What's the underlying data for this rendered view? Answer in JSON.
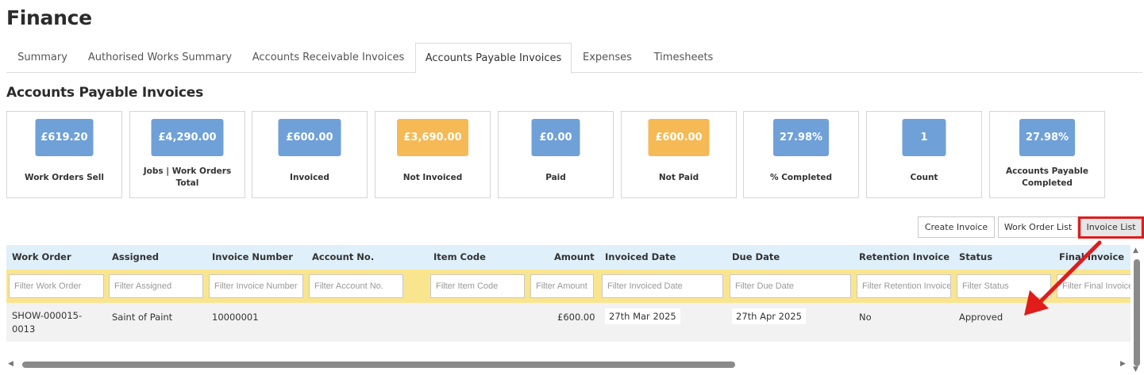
{
  "page": {
    "title": "Finance"
  },
  "tabs": [
    {
      "label": "Summary"
    },
    {
      "label": "Authorised Works Summary"
    },
    {
      "label": "Accounts Receivable Invoices"
    },
    {
      "label": "Accounts Payable Invoices"
    },
    {
      "label": "Expenses"
    },
    {
      "label": "Timesheets"
    }
  ],
  "active_tab": "Accounts Payable Invoices",
  "section": {
    "title": "Accounts Payable Invoices"
  },
  "colors": {
    "card_blue": "#6fa0d8",
    "card_orange": "#f5b955",
    "header_bg": "#dff0fb",
    "filter_bg": "#fae58f",
    "highlight": "#e21b1b"
  },
  "cards": [
    {
      "value": "£619.20",
      "label": "Work Orders Sell",
      "color": "blue"
    },
    {
      "value": "£4,290.00",
      "label": "Jobs | Work Orders Total",
      "color": "blue"
    },
    {
      "value": "£600.00",
      "label": "Invoiced",
      "color": "blue"
    },
    {
      "value": "£3,690.00",
      "label": "Not Invoiced",
      "color": "orange"
    },
    {
      "value": "£0.00",
      "label": "Paid",
      "color": "blue"
    },
    {
      "value": "£600.00",
      "label": "Not Paid",
      "color": "orange"
    },
    {
      "value": "27.98%",
      "label": "% Completed",
      "color": "blue"
    },
    {
      "value": "1",
      "label": "Count",
      "color": "blue"
    },
    {
      "value": "27.98%",
      "label": "Accounts Payable Completed",
      "color": "blue"
    }
  ],
  "buttons": {
    "create_invoice": "Create Invoice",
    "work_order_list": "Work Order List",
    "invoice_list": "Invoice List"
  },
  "table": {
    "columns": [
      "Work Order",
      "Assigned",
      "Invoice Number",
      "Account No.",
      "Item Code",
      "Amount",
      "Invoiced Date",
      "Due Date",
      "Retention Invoice",
      "Status",
      "Final Invoice"
    ],
    "filters": [
      "Filter Work Order",
      "Filter Assigned",
      "Filter Invoice Number",
      "Filter Account No.",
      "Filter Item Code",
      "Filter Amount",
      "Filter Invoiced Date",
      "Filter Due Date",
      "Filter Retention Invoice",
      "Filter Status",
      "Filter Final Invoice"
    ],
    "rows": [
      {
        "work_order": "SHOW-000015-\n0013",
        "assigned": "Saint of Paint",
        "invoice_number": "10000001",
        "account_no": "",
        "item_code": "",
        "amount": "£600.00",
        "invoiced_date": "27th Mar 2025",
        "due_date": "27th Apr 2025",
        "retention_invoice": "No",
        "status": "Approved",
        "final_invoice": ""
      }
    ]
  }
}
